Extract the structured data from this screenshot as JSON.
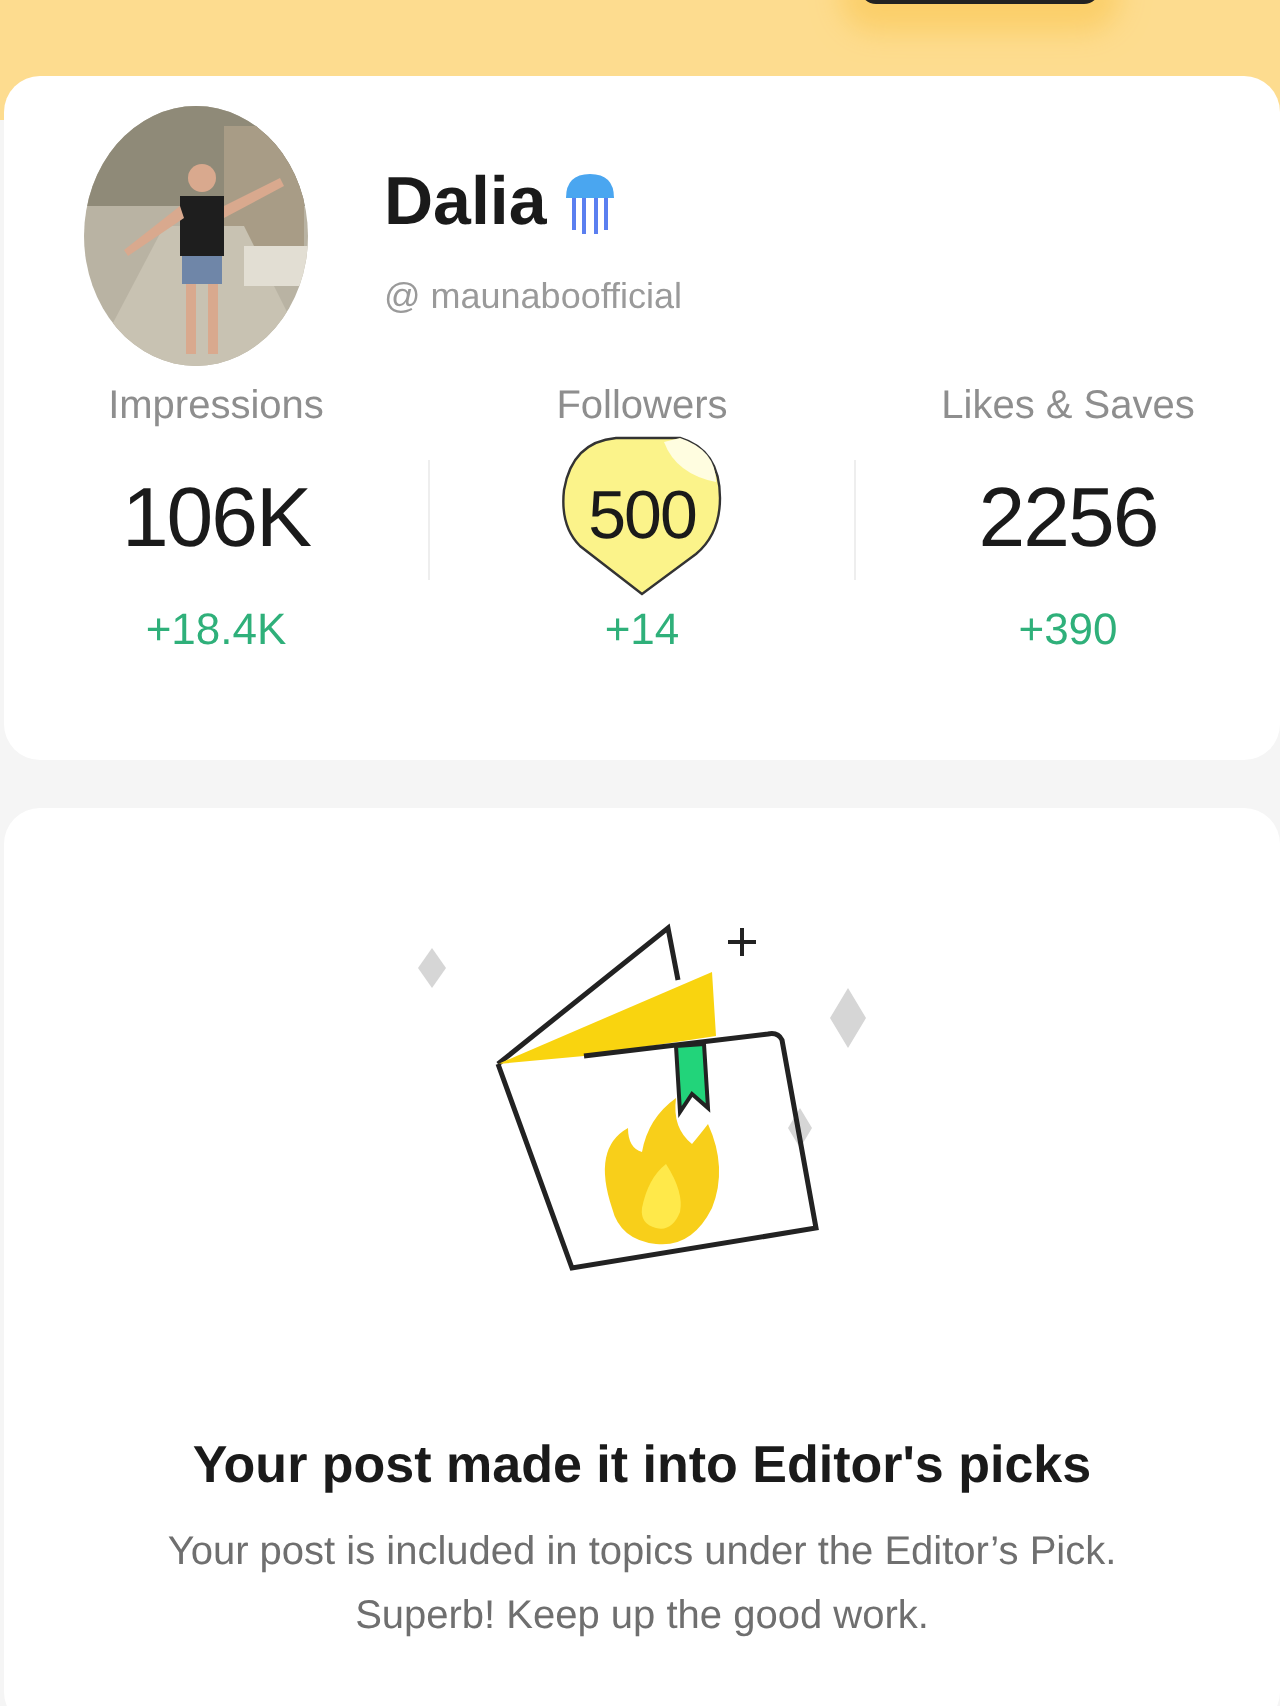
{
  "profile": {
    "name": "Dalia",
    "handle": "@ maunaboofficial"
  },
  "stats": [
    {
      "label": "Impressions",
      "value": "106K",
      "change": "+18.4K",
      "highlighted": false
    },
    {
      "label": "Followers",
      "value": "500",
      "change": "+14",
      "highlighted": true
    },
    {
      "label": "Likes & Saves",
      "value": "2256",
      "change": "+390",
      "highlighted": false
    }
  ],
  "achievement": {
    "title": "Your post made it into Editor's picks",
    "message": "Your post is included in topics under the Editor’s Pick. Superb! Keep up the good work."
  }
}
